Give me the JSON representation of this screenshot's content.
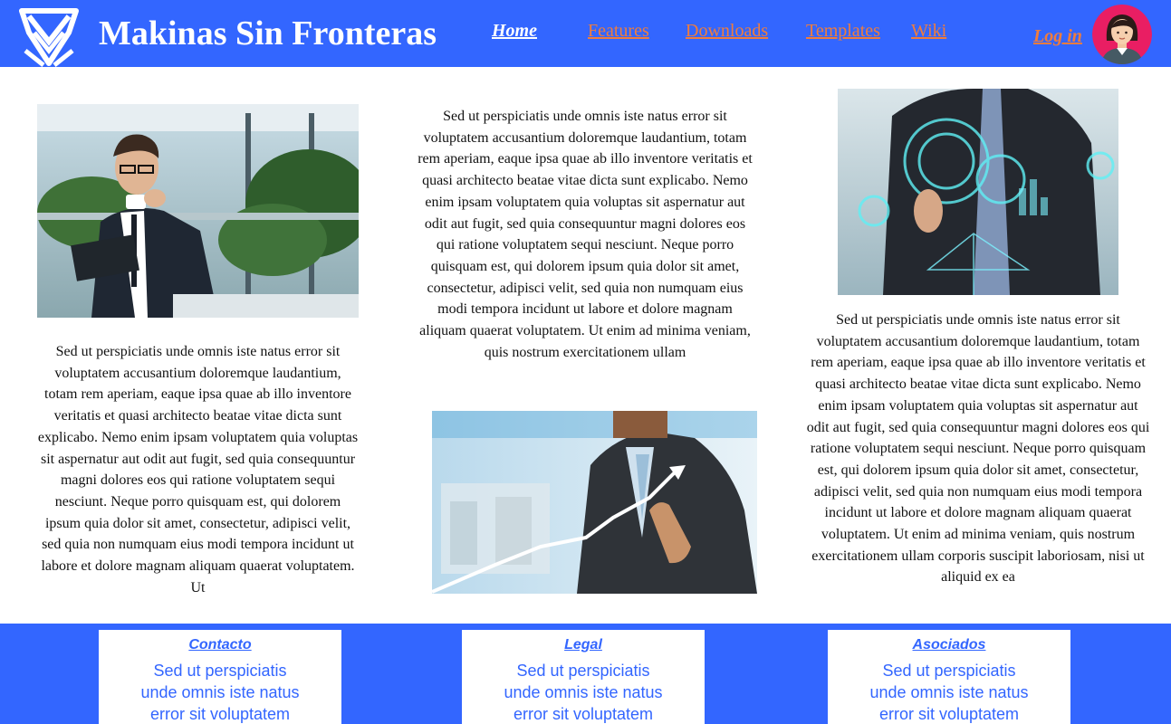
{
  "header": {
    "title": "Makinas Sin Fronteras",
    "nav": [
      {
        "label": "Home"
      },
      {
        "label": "Features"
      },
      {
        "label": "Downloads"
      },
      {
        "label": "Templates"
      },
      {
        "label": "Wiki"
      }
    ],
    "login_label": "Log in"
  },
  "main": {
    "left_text": "Sed ut perspiciatis unde omnis iste natus error sit voluptatem accusantium doloremque laudantium, totam rem aperiam, eaque ipsa quae ab illo inventore veritatis et quasi architecto beatae vitae dicta sunt explicabo. Nemo enim ipsam voluptatem quia voluptas sit aspernatur aut odit aut fugit, sed quia consequuntur magni dolores eos qui ratione voluptatem sequi nesciunt. Neque porro quisquam est, qui dolorem ipsum quia dolor sit amet, consectetur, adipisci velit, sed quia non numquam eius modi tempora incidunt ut labore et dolore magnam aliquam quaerat voluptatem. Ut",
    "center_text": "Sed ut perspiciatis unde omnis iste natus error sit voluptatem accusantium doloremque laudantium, totam rem aperiam, eaque ipsa quae ab illo inventore veritatis et quasi architecto beatae vitae dicta sunt explicabo. Nemo enim ipsam voluptatem quia voluptas sit aspernatur aut odit aut fugit, sed quia consequuntur magni dolores eos qui ratione voluptatem sequi nesciunt. Neque porro quisquam est, qui dolorem ipsum quia dolor sit amet, consectetur, adipisci velit, sed quia non numquam eius modi tempora incidunt ut labore et dolore magnam aliquam quaerat voluptatem. Ut enim ad minima veniam, quis nostrum exercitationem ullam",
    "right_text": "Sed ut perspiciatis unde omnis iste natus error sit voluptatem accusantium doloremque laudantium, totam rem aperiam, eaque ipsa quae ab illo inventore veritatis et quasi architecto beatae vitae dicta sunt explicabo. Nemo enim ipsam voluptatem quia voluptas sit aspernatur aut odit aut fugit, sed quia consequuntur magni dolores eos qui ratione voluptatem sequi nesciunt. Neque porro quisquam est, qui dolorem ipsum quia dolor sit amet, consectetur, adipisci velit, sed quia non numquam eius modi tempora incidunt ut labore et dolore magnam aliquam quaerat voluptatem. Ut enim ad minima veniam, quis nostrum exercitationem ullam corporis suscipit laboriosam, nisi ut aliquid ex ea"
  },
  "footer": {
    "cards": [
      {
        "heading": "Contacto",
        "text": "Sed ut perspiciatis unde omnis iste natus error sit voluptatem"
      },
      {
        "heading": "Legal",
        "text": "Sed ut perspiciatis unde omnis iste natus error sit voluptatem"
      },
      {
        "heading": "Asociados",
        "text": "Sed ut perspiciatis unde omnis iste natus error sit voluptatem"
      }
    ]
  },
  "colors": {
    "brand_blue": "#3366ff",
    "link_orange": "#f07c3c",
    "white": "#ffffff"
  },
  "icons": {
    "logo": "shield-v-logo",
    "avatar": "user-avatar-icon"
  }
}
